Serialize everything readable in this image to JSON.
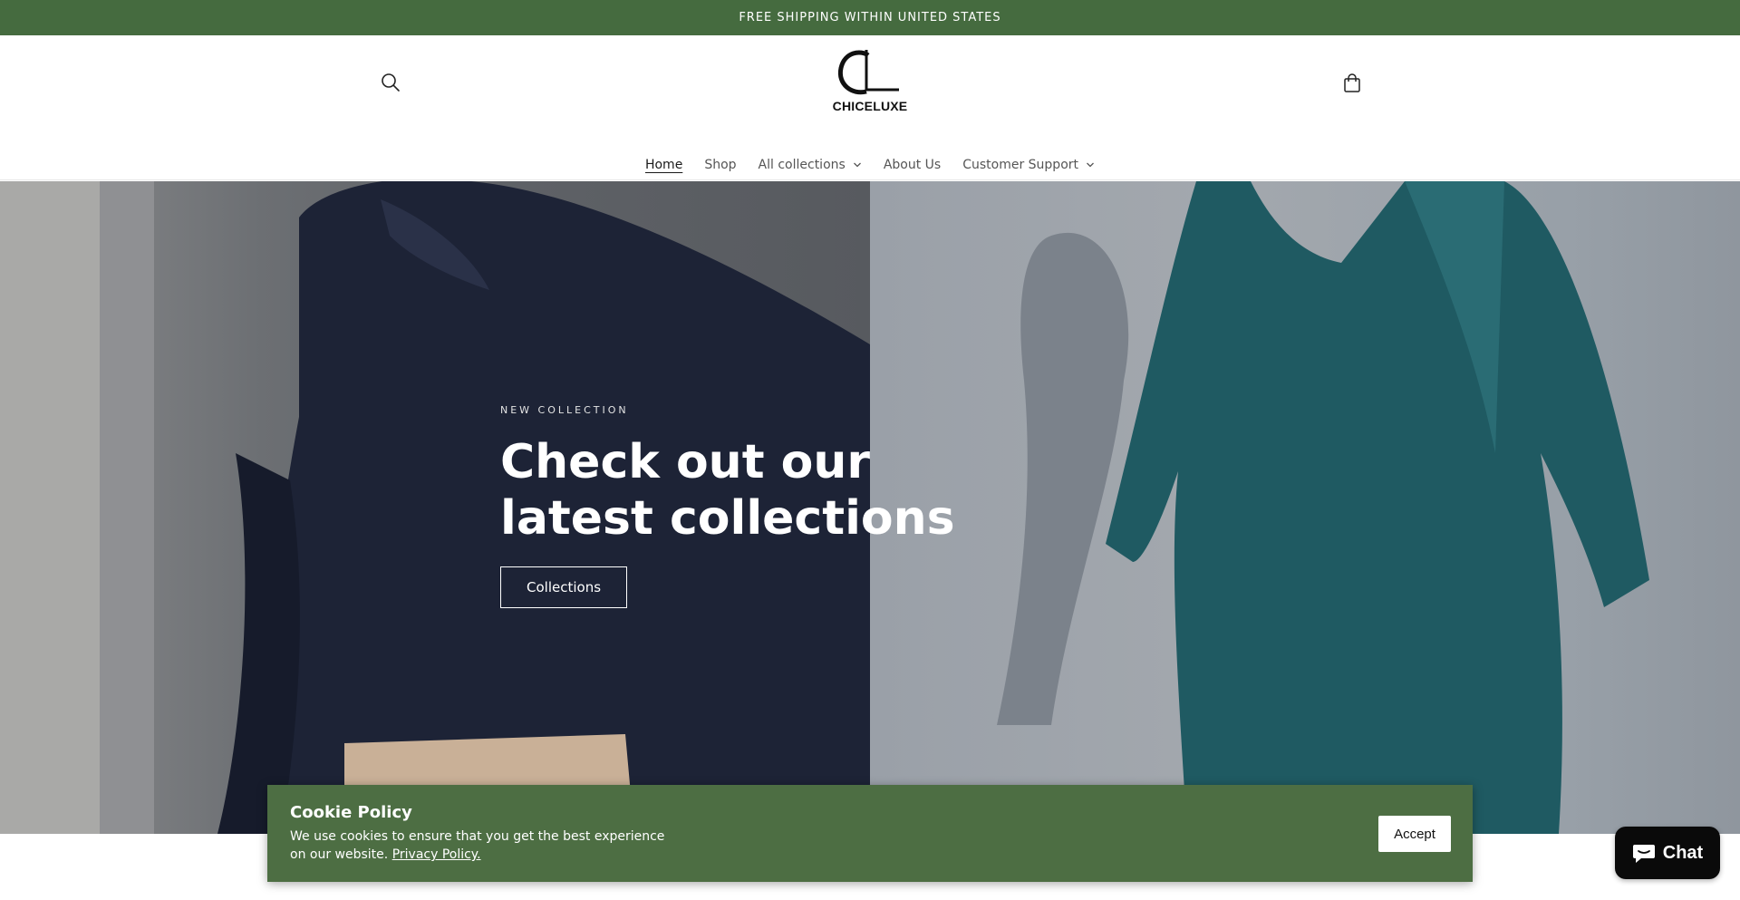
{
  "announcement": {
    "text": "FREE SHIPPING WITHIN UNITED STATES"
  },
  "header": {
    "logo_text": "CHICELUXE",
    "search_icon": "search-icon",
    "cart_icon": "shopping-bag-icon"
  },
  "nav": {
    "items": [
      {
        "label": "Home",
        "active": true
      },
      {
        "label": "Shop"
      },
      {
        "label": "All collections",
        "has_dropdown": true
      },
      {
        "label": "About Us"
      },
      {
        "label": "Customer Support",
        "has_dropdown": true
      }
    ]
  },
  "hero": {
    "eyebrow": "NEW COLLECTION",
    "title": "Check out our latest collections",
    "button_label": "Collections"
  },
  "cookie": {
    "title": "Cookie Policy",
    "message": "We use cookies to ensure that you get the best experience on our website.",
    "link_text": "Privacy Policy.",
    "accept_label": "Accept",
    "background": "#4d6e43"
  },
  "chat": {
    "label": "Chat",
    "icon": "chat-bubble-icon"
  },
  "colors": {
    "announcement_bg": "#456b3f",
    "cookie_bg": "#4d6e43"
  }
}
